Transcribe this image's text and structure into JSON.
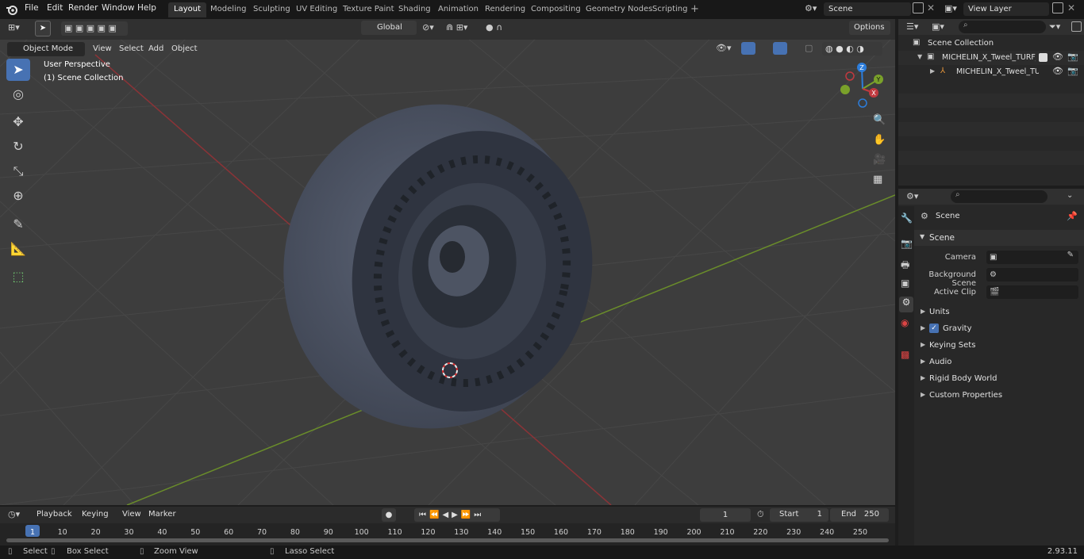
{
  "menus": [
    "File",
    "Edit",
    "Render",
    "Window",
    "Help"
  ],
  "workspaces": [
    "Layout",
    "Modeling",
    "Sculpting",
    "UV Editing",
    "Texture Paint",
    "Shading",
    "Animation",
    "Rendering",
    "Compositing",
    "Geometry Nodes",
    "Scripting"
  ],
  "scene_field": "Scene",
  "view_layer_field": "View Layer",
  "viewport": {
    "mode": "Object Mode",
    "menu_view": "View",
    "menu_select": "Select",
    "menu_add": "Add",
    "menu_object": "Object",
    "transform_orientation": "Global",
    "options": "Options",
    "overlay_line1": "User Perspective",
    "overlay_line2": "(1) Scene Collection",
    "gizmo_x": "X",
    "gizmo_y": "Y",
    "gizmo_z": "Z"
  },
  "outliner": {
    "root": "Scene Collection",
    "item1": "MICHELIN_X_Tweel_TURF_Tir",
    "item2": "MICHELIN_X_Tweel_TURI"
  },
  "properties": {
    "header": "Scene",
    "panel": "Scene",
    "camera_label": "Camera",
    "bg_label": "Background Scene",
    "clip_label": "Active Clip",
    "sections": [
      "Units",
      "Gravity",
      "Keying Sets",
      "Audio",
      "Rigid Body World",
      "Custom Properties"
    ],
    "gravity_checked": true
  },
  "timeline": {
    "playback": "Playback",
    "keying": "Keying",
    "view": "View",
    "marker": "Marker",
    "current_frame": "1",
    "start_label": "Start",
    "start": "1",
    "end_label": "End",
    "end": "250",
    "ticks": [
      "1",
      "10",
      "20",
      "30",
      "40",
      "50",
      "60",
      "70",
      "80",
      "90",
      "100",
      "110",
      "120",
      "130",
      "140",
      "150",
      "160",
      "170",
      "180",
      "190",
      "200",
      "210",
      "220",
      "230",
      "240",
      "250"
    ]
  },
  "status": {
    "select": "Select",
    "box_select": "Box Select",
    "zoom_view": "Zoom View",
    "lasso_select": "Lasso Select",
    "version": "2.93.11"
  },
  "colors": {
    "accent": "#4772b3",
    "x_axis": "#c0393f",
    "y_axis": "#7aa12a",
    "z_axis": "#2c7ddb"
  }
}
